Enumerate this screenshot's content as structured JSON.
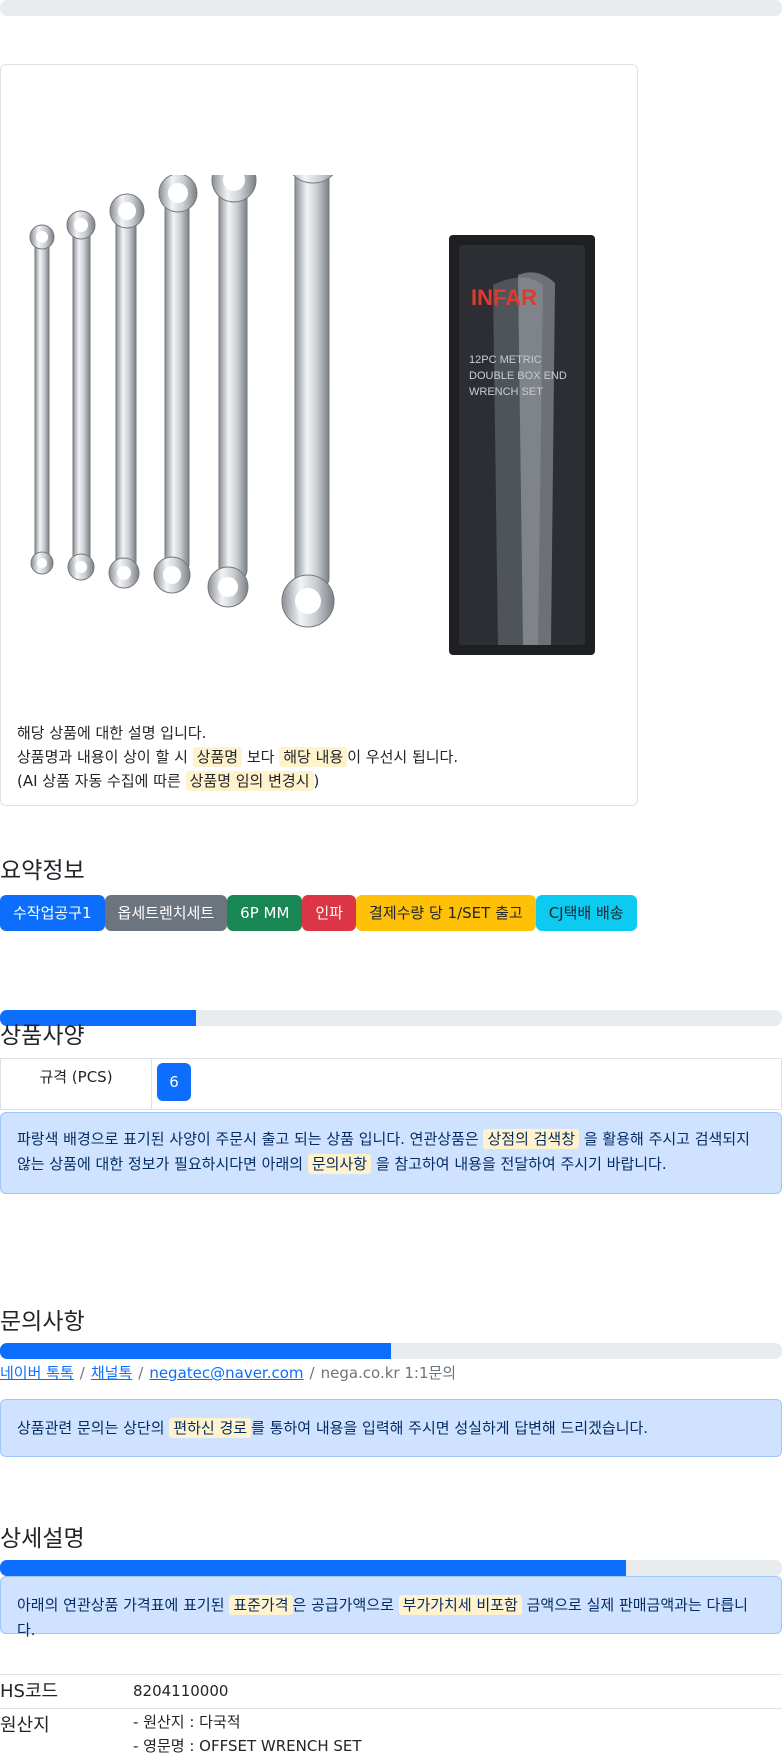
{
  "top_progress": {
    "percent": 0
  },
  "card": {
    "line1": "해당 상품에 대한 설명 입니다.",
    "line2": {
      "a": "상품명과 내용이 상이 할 시",
      "hl1": "상품명",
      "b": "보다",
      "hl2": "해당 내용",
      "c": "이 우선시 됩니다."
    },
    "line3": {
      "a": "(AI 상품 자동 수집에 따른",
      "hl": "상품명 임의 변경시",
      "b": ")"
    },
    "image": {
      "brand": "INFAR",
      "package_line1": "12PC METRIC",
      "package_line2": "DOUBLE BOX END",
      "package_line3": "WRENCH SET"
    }
  },
  "summary": {
    "title": "요약정보",
    "badges": [
      {
        "label": "수작업공구1",
        "color": "#0d6efd",
        "text_color": "#ffffff"
      },
      {
        "label": "옵세트렌치세트",
        "color": "#6c757d",
        "text_color": "#ffffff"
      },
      {
        "label": "6P MM",
        "color": "#198754",
        "text_color": "#ffffff"
      },
      {
        "label": "인파",
        "color": "#dc3545",
        "text_color": "#ffffff"
      },
      {
        "label": "결제수량 당 1/SET 출고",
        "color": "#ffc107",
        "text_color": "#212529"
      },
      {
        "label": "CJ택배 배송",
        "color": "#0dcaf0",
        "text_color": "#212529"
      }
    ]
  },
  "specs": {
    "progress_percent": 25,
    "title": "상품사양",
    "label": "규격 (PCS)",
    "value": "6",
    "notice": {
      "a": "파랑색 배경으로 표기된 사양이 주문시 출고 되는 상품 입니다. 연관상품은",
      "hl1": "상점의 검색창",
      "b": "을 활용해 주시고 검색되지 않는 상품에 대한 정보가 필요하시다면 아래의",
      "hl2": "문의사항",
      "c": "을 참고하여 내용을 전달하여 주시기 바랍니다."
    }
  },
  "inquiry": {
    "title": "문의사항",
    "progress_percent": 50,
    "links": [
      "네이버 톡톡",
      "채널톡",
      "negatec@naver.com"
    ],
    "current": "nega.co.kr 1:1문의",
    "notice": {
      "a": "상품관련 문의는 상단의",
      "hl": "편하신 경로",
      "b": "를 통하여 내용을 입력해 주시면 성실하게 답변해 드리겠습니다."
    }
  },
  "detail": {
    "title": "상세설명",
    "progress_percent": 80,
    "notice": {
      "a": "아래의 연관상품 가격표에 표기된",
      "hl1": "표준가격",
      "b": "은 공급가액으로",
      "hl2": "부가가치세 비포함",
      "c": "금액으로 실제 판매금액과는 다릅니다."
    }
  },
  "info": {
    "hs_label": "HS코드",
    "hs_value": "8204110000",
    "origin_label": "원산지",
    "origin_line1": "- 원산지 : 다국적",
    "origin_line2": "- 영문명 : OFFSET WRENCH SET"
  }
}
